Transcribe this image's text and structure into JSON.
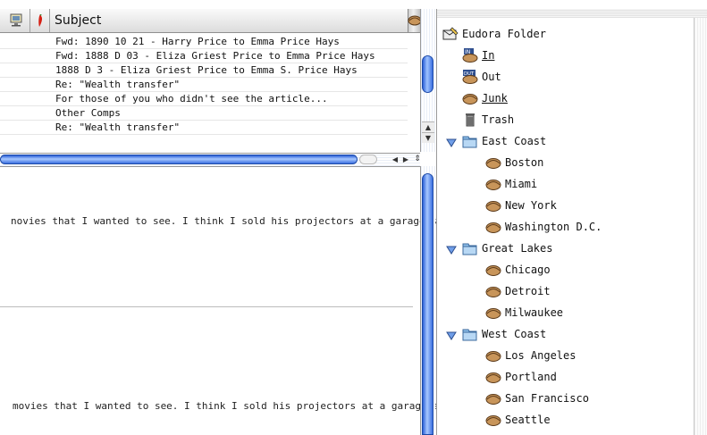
{
  "message_list": {
    "header": {
      "subject_label": "Subject"
    },
    "rows": [
      "Fwd: 1890 10 21 - Harry Price to Emma Price Hays",
      "Fwd: 1888 D 03 - Eliza Griest Price to Emma Price Hays",
      "1888 D 3 - Eliza Griest Price to Emma S. Price Hays",
      "Re: \"Wealth transfer\"",
      "For those of you who didn't see the article...",
      "Other Comps",
      "Re: \"Wealth transfer\""
    ]
  },
  "preview": {
    "line_1": "novies that I wanted to see. I think I sold his projectors at a garage sale a",
    "line_2": "movies that I wanted to see. I think I sold his projectors at a garage sale"
  },
  "folders": {
    "root": {
      "label": "Eudora Folder",
      "icon": "eudora-folder-icon"
    },
    "mailboxes": [
      {
        "label": "In",
        "icon": "in-mailbox-icon",
        "underlined": true
      },
      {
        "label": "Out",
        "icon": "out-mailbox-icon",
        "underlined": false
      },
      {
        "label": "Junk",
        "icon": "junk-mailbox-icon",
        "underlined": true
      },
      {
        "label": "Trash",
        "icon": "trash-icon",
        "underlined": false
      }
    ],
    "groups": [
      {
        "label": "East Coast",
        "children": [
          "Boston",
          "Miami",
          "New York",
          "Washington D.C."
        ]
      },
      {
        "label": "Great Lakes",
        "children": [
          "Chicago",
          "Detroit",
          "Milwaukee"
        ]
      },
      {
        "label": "West Coast",
        "children": [
          "Los Angeles",
          "Portland",
          "San Francisco",
          "Seattle"
        ]
      }
    ]
  },
  "colors": {
    "scroll_blue": "#3b6fe0",
    "folder_blue": "#8fbfe8",
    "mailbox_tan": "#c8955a"
  }
}
